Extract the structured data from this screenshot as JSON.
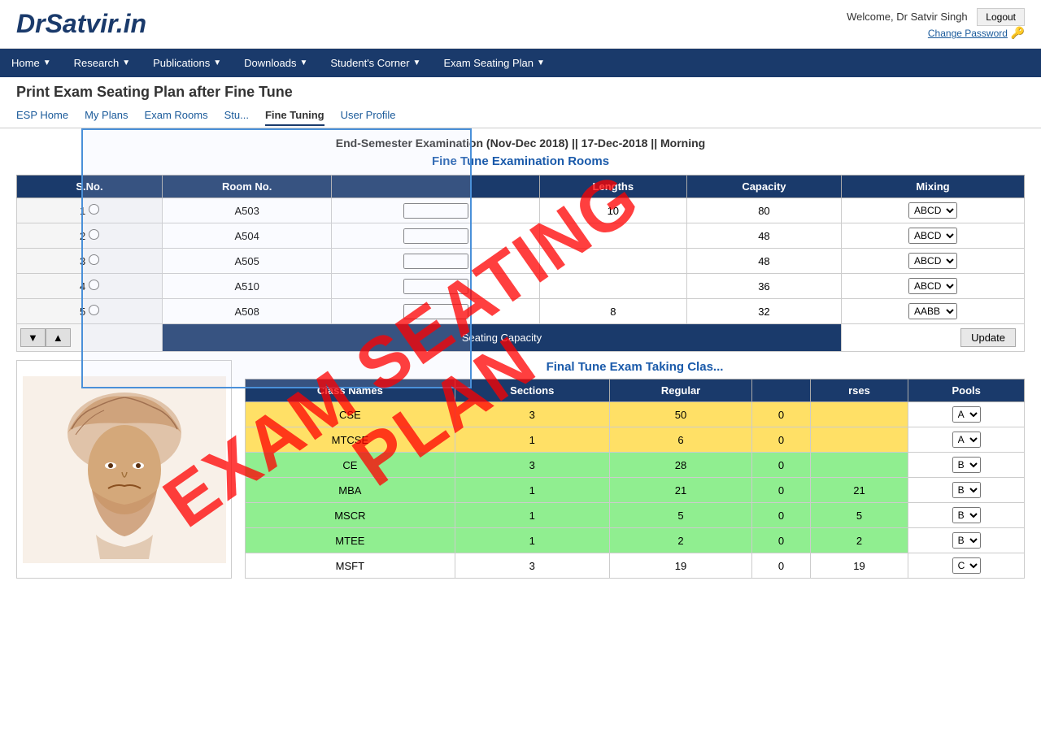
{
  "header": {
    "logo": "DrSatvir.in",
    "welcome_text": "Welcome, Dr Satvir Singh",
    "logout_label": "Logout",
    "change_password_label": "Change Password"
  },
  "nav": {
    "items": [
      {
        "label": "Home",
        "has_arrow": true
      },
      {
        "label": "Research",
        "has_arrow": true
      },
      {
        "label": "Publications",
        "has_arrow": true
      },
      {
        "label": "Downloads",
        "has_arrow": true
      },
      {
        "label": "Student's Corner",
        "has_arrow": true
      },
      {
        "label": "Exam Seating Plan",
        "has_arrow": true
      }
    ]
  },
  "page": {
    "title": "Print Exam Seating Plan after Fine Tune",
    "sub_nav": [
      {
        "label": "ESP Home",
        "active": false
      },
      {
        "label": "My Plans",
        "active": false
      },
      {
        "label": "Exam Rooms",
        "active": false
      },
      {
        "label": "Stu...",
        "active": false
      },
      {
        "label": "Fine Tuning",
        "active": true
      },
      {
        "label": "User Profile",
        "active": false
      }
    ]
  },
  "exam_info": "End-Semester Examination (Nov-Dec 2018) || 17-Dec-2018 || Morning",
  "fine_tune_title": "Fine Tune Examination Rooms",
  "rooms_table": {
    "headers": [
      "S.No.",
      "Room No.",
      "",
      "Lengths",
      "Capacity",
      "Mixing"
    ],
    "rows": [
      {
        "sno": "1",
        "room": "A503",
        "col3": "",
        "lengths": "10",
        "capacity": "80",
        "mixing": "ABCD"
      },
      {
        "sno": "2",
        "room": "A504",
        "col3": "",
        "lengths": "",
        "capacity": "48",
        "mixing": "ABCD"
      },
      {
        "sno": "3",
        "room": "A505",
        "col3": "",
        "lengths": "",
        "capacity": "48",
        "mixing": "ABCD"
      },
      {
        "sno": "4",
        "room": "A510",
        "col3": "",
        "lengths": "",
        "capacity": "36",
        "mixing": "ABCD"
      },
      {
        "sno": "5",
        "room": "A508",
        "col3": "",
        "lengths": "8",
        "capacity": "32",
        "mixing": "AABB"
      }
    ],
    "seating_capacity_label": "Seating Capacity",
    "update_label": "Update",
    "down_arrow": "▼",
    "up_arrow": "▲"
  },
  "final_tune_title": "Final Tune Exam Taking Clas...",
  "classes_table": {
    "headers": [
      "Class Names",
      "Sections",
      "Regular",
      "",
      "rses",
      "Pools"
    ],
    "rows": [
      {
        "name": "CSE",
        "sections": "3",
        "regular": "50",
        "col4": "0",
        "col5": "",
        "pools": "A",
        "color": "yellow"
      },
      {
        "name": "MTCSE",
        "sections": "1",
        "regular": "6",
        "col4": "0",
        "col5": "",
        "pools": "A",
        "color": "yellow"
      },
      {
        "name": "CE",
        "sections": "3",
        "regular": "28",
        "col4": "0",
        "col5": "",
        "pools": "B",
        "color": "green"
      },
      {
        "name": "MBA",
        "sections": "1",
        "regular": "21",
        "col4": "0",
        "col5": "21",
        "pools": "B",
        "color": "green"
      },
      {
        "name": "MSCR",
        "sections": "1",
        "regular": "5",
        "col4": "0",
        "col5": "5",
        "pools": "B",
        "color": "green"
      },
      {
        "name": "MTEE",
        "sections": "1",
        "regular": "2",
        "col4": "0",
        "col5": "2",
        "pools": "B",
        "color": "green"
      },
      {
        "name": "MSFT",
        "sections": "3",
        "regular": "19",
        "col4": "0",
        "col5": "19",
        "pools": "C",
        "color": "white"
      }
    ]
  },
  "watermark": {
    "line1": "EXAM SEATING",
    "line2": "PLAN"
  }
}
